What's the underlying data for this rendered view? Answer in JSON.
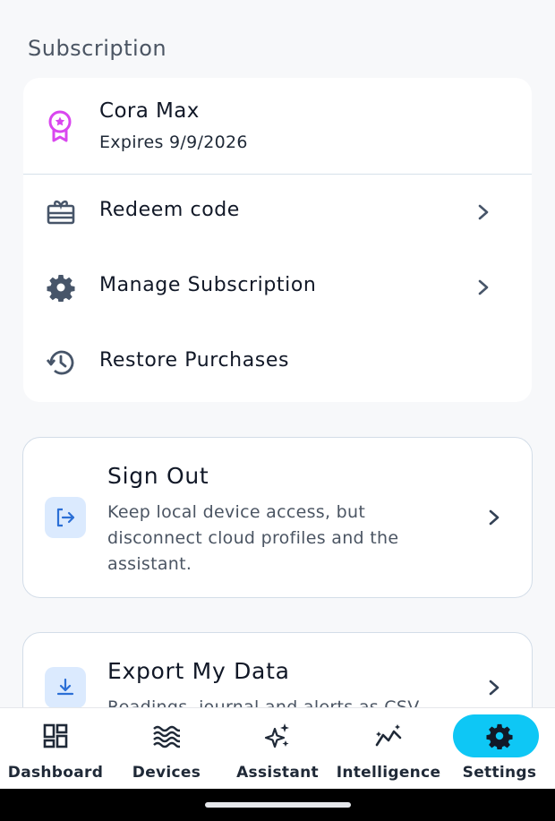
{
  "section": {
    "title": "Subscription"
  },
  "plan": {
    "name": "Cora Max",
    "expires": "Expires 9/9/2026",
    "icon": "award-badge-icon",
    "icon_color": "#d946ef"
  },
  "rows": [
    {
      "label": "Redeem code",
      "icon": "gift-card-icon"
    },
    {
      "label": "Manage Subscription",
      "icon": "gear-icon"
    },
    {
      "label": "Restore Purchases",
      "icon": "history-icon"
    }
  ],
  "sign_out": {
    "title": "Sign Out",
    "description": "Keep local device access, but disconnect cloud profiles and the assistant.",
    "icon": "logout-icon"
  },
  "export": {
    "title": "Export My Data",
    "description": "Readings, journal and alerts as CSV",
    "icon": "download-icon"
  },
  "nav": {
    "items": [
      {
        "label": "Dashboard",
        "icon": "dashboard-grid-icon"
      },
      {
        "label": "Devices",
        "icon": "waves-icon"
      },
      {
        "label": "Assistant",
        "icon": "sparkles-icon"
      },
      {
        "label": "Intelligence",
        "icon": "trend-line-icon"
      },
      {
        "label": "Settings",
        "icon": "gear-icon",
        "active": true
      }
    ],
    "active_color": "#0ec7f5"
  },
  "colors": {
    "accent": "#2b6fd6",
    "icon_gray": "#475569"
  }
}
